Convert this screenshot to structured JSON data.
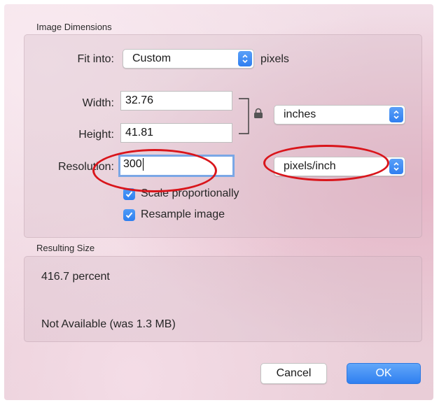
{
  "image_dimensions": {
    "section_title": "Image Dimensions",
    "fit_into_label": "Fit into:",
    "fit_into_value": "Custom",
    "fit_into_unit": "pixels",
    "width_label": "Width:",
    "width_value": "32.76",
    "height_label": "Height:",
    "height_value": "41.81",
    "size_unit_value": "inches",
    "resolution_label": "Resolution:",
    "resolution_value": "300",
    "resolution_unit_value": "pixels/inch",
    "scale_proportionally_label": "Scale proportionally",
    "scale_proportionally_checked": true,
    "resample_image_label": "Resample image",
    "resample_image_checked": true
  },
  "resulting_size": {
    "section_title": "Resulting Size",
    "percent_text": "416.7 percent",
    "file_size_text": "Not Available (was 1.3 MB)"
  },
  "buttons": {
    "cancel_label": "Cancel",
    "ok_label": "OK"
  },
  "colors": {
    "accent": "#2f7ff0",
    "annotation": "#d9151b"
  },
  "icons": [
    "lock-icon",
    "stepper-arrows-icon",
    "checkmark-icon",
    "link-bracket-icon"
  ]
}
